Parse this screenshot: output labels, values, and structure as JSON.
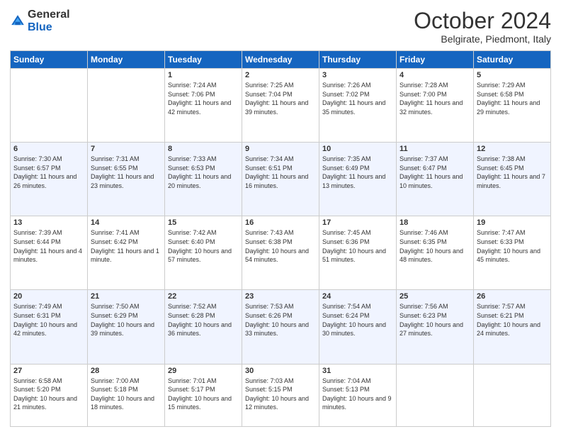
{
  "logo": {
    "general": "General",
    "blue": "Blue"
  },
  "title": "October 2024",
  "location": "Belgirate, Piedmont, Italy",
  "headers": [
    "Sunday",
    "Monday",
    "Tuesday",
    "Wednesday",
    "Thursday",
    "Friday",
    "Saturday"
  ],
  "weeks": [
    {
      "alt": false,
      "days": [
        {
          "num": "",
          "empty": true
        },
        {
          "num": "",
          "empty": true
        },
        {
          "num": "1",
          "info": "Sunrise: 7:24 AM\nSunset: 7:06 PM\nDaylight: 11 hours and 42 minutes."
        },
        {
          "num": "2",
          "info": "Sunrise: 7:25 AM\nSunset: 7:04 PM\nDaylight: 11 hours and 39 minutes."
        },
        {
          "num": "3",
          "info": "Sunrise: 7:26 AM\nSunset: 7:02 PM\nDaylight: 11 hours and 35 minutes."
        },
        {
          "num": "4",
          "info": "Sunrise: 7:28 AM\nSunset: 7:00 PM\nDaylight: 11 hours and 32 minutes."
        },
        {
          "num": "5",
          "info": "Sunrise: 7:29 AM\nSunset: 6:58 PM\nDaylight: 11 hours and 29 minutes."
        }
      ]
    },
    {
      "alt": true,
      "days": [
        {
          "num": "6",
          "info": "Sunrise: 7:30 AM\nSunset: 6:57 PM\nDaylight: 11 hours and 26 minutes."
        },
        {
          "num": "7",
          "info": "Sunrise: 7:31 AM\nSunset: 6:55 PM\nDaylight: 11 hours and 23 minutes."
        },
        {
          "num": "8",
          "info": "Sunrise: 7:33 AM\nSunset: 6:53 PM\nDaylight: 11 hours and 20 minutes."
        },
        {
          "num": "9",
          "info": "Sunrise: 7:34 AM\nSunset: 6:51 PM\nDaylight: 11 hours and 16 minutes."
        },
        {
          "num": "10",
          "info": "Sunrise: 7:35 AM\nSunset: 6:49 PM\nDaylight: 11 hours and 13 minutes."
        },
        {
          "num": "11",
          "info": "Sunrise: 7:37 AM\nSunset: 6:47 PM\nDaylight: 11 hours and 10 minutes."
        },
        {
          "num": "12",
          "info": "Sunrise: 7:38 AM\nSunset: 6:45 PM\nDaylight: 11 hours and 7 minutes."
        }
      ]
    },
    {
      "alt": false,
      "days": [
        {
          "num": "13",
          "info": "Sunrise: 7:39 AM\nSunset: 6:44 PM\nDaylight: 11 hours and 4 minutes."
        },
        {
          "num": "14",
          "info": "Sunrise: 7:41 AM\nSunset: 6:42 PM\nDaylight: 11 hours and 1 minute."
        },
        {
          "num": "15",
          "info": "Sunrise: 7:42 AM\nSunset: 6:40 PM\nDaylight: 10 hours and 57 minutes."
        },
        {
          "num": "16",
          "info": "Sunrise: 7:43 AM\nSunset: 6:38 PM\nDaylight: 10 hours and 54 minutes."
        },
        {
          "num": "17",
          "info": "Sunrise: 7:45 AM\nSunset: 6:36 PM\nDaylight: 10 hours and 51 minutes."
        },
        {
          "num": "18",
          "info": "Sunrise: 7:46 AM\nSunset: 6:35 PM\nDaylight: 10 hours and 48 minutes."
        },
        {
          "num": "19",
          "info": "Sunrise: 7:47 AM\nSunset: 6:33 PM\nDaylight: 10 hours and 45 minutes."
        }
      ]
    },
    {
      "alt": true,
      "days": [
        {
          "num": "20",
          "info": "Sunrise: 7:49 AM\nSunset: 6:31 PM\nDaylight: 10 hours and 42 minutes."
        },
        {
          "num": "21",
          "info": "Sunrise: 7:50 AM\nSunset: 6:29 PM\nDaylight: 10 hours and 39 minutes."
        },
        {
          "num": "22",
          "info": "Sunrise: 7:52 AM\nSunset: 6:28 PM\nDaylight: 10 hours and 36 minutes."
        },
        {
          "num": "23",
          "info": "Sunrise: 7:53 AM\nSunset: 6:26 PM\nDaylight: 10 hours and 33 minutes."
        },
        {
          "num": "24",
          "info": "Sunrise: 7:54 AM\nSunset: 6:24 PM\nDaylight: 10 hours and 30 minutes."
        },
        {
          "num": "25",
          "info": "Sunrise: 7:56 AM\nSunset: 6:23 PM\nDaylight: 10 hours and 27 minutes."
        },
        {
          "num": "26",
          "info": "Sunrise: 7:57 AM\nSunset: 6:21 PM\nDaylight: 10 hours and 24 minutes."
        }
      ]
    },
    {
      "alt": false,
      "days": [
        {
          "num": "27",
          "info": "Sunrise: 6:58 AM\nSunset: 5:20 PM\nDaylight: 10 hours and 21 minutes."
        },
        {
          "num": "28",
          "info": "Sunrise: 7:00 AM\nSunset: 5:18 PM\nDaylight: 10 hours and 18 minutes."
        },
        {
          "num": "29",
          "info": "Sunrise: 7:01 AM\nSunset: 5:17 PM\nDaylight: 10 hours and 15 minutes."
        },
        {
          "num": "30",
          "info": "Sunrise: 7:03 AM\nSunset: 5:15 PM\nDaylight: 10 hours and 12 minutes."
        },
        {
          "num": "31",
          "info": "Sunrise: 7:04 AM\nSunset: 5:13 PM\nDaylight: 10 hours and 9 minutes."
        },
        {
          "num": "",
          "empty": true
        },
        {
          "num": "",
          "empty": true
        }
      ]
    }
  ]
}
